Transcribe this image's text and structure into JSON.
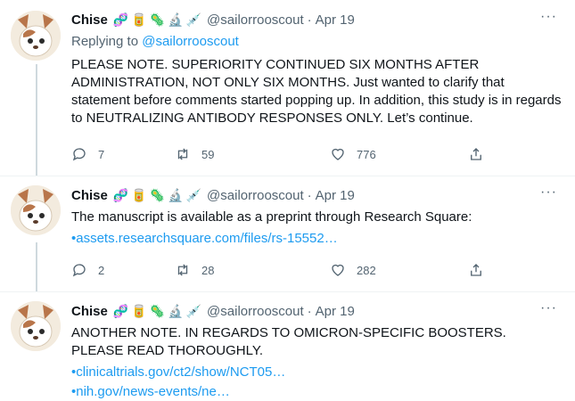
{
  "tweets": [
    {
      "name": "Chise",
      "emoji": [
        "🧬",
        "🥫",
        "🦠",
        "🔬",
        "💉"
      ],
      "handle": "@sailorrooscout",
      "sep": "·",
      "date": "Apr 19",
      "more": "···",
      "replying_prefix": "Replying to",
      "replying_to": "@sailorrooscout",
      "text": "PLEASE NOTE. SUPERIORITY CONTINUED SIX MONTHS AFTER ADMINISTRATION, NOT ONLY SIX MONTHS. Just wanted to clarify that statement before comments started popping up. In addition, this study is in regards to NEUTRALIZING ANTIBODY RESPONSES ONLY. Let’s continue.",
      "replies": "7",
      "retweets": "59",
      "likes": "776"
    },
    {
      "name": "Chise",
      "emoji": [
        "🧬",
        "🥫",
        "🦠",
        "🔬",
        "💉"
      ],
      "handle": "@sailorrooscout",
      "sep": "·",
      "date": "Apr 19",
      "more": "···",
      "text": "The manuscript is available as a preprint through Research Square:",
      "link1": "•assets.researchsquare.com/files/rs-15552…",
      "replies": "2",
      "retweets": "28",
      "likes": "282"
    },
    {
      "name": "Chise",
      "emoji": [
        "🧬",
        "🥫",
        "🦠",
        "🔬",
        "💉"
      ],
      "handle": "@sailorrooscout",
      "sep": "·",
      "date": "Apr 19",
      "more": "···",
      "text": "ANOTHER NOTE. IN REGARDS TO OMICRON-SPECIFIC BOOSTERS. PLEASE READ THOROUGHLY.",
      "link1": "•clinicaltrials.gov/ct2/show/NCT05…",
      "link2": "•nih.gov/news-events/ne…"
    }
  ],
  "icons": {
    "reply": "reply-icon",
    "retweet": "retweet-icon",
    "like": "like-icon",
    "share": "share-icon"
  },
  "colors": {
    "link": "#1d9bf0",
    "secondary": "#536471",
    "thread_line": "#cfd9de"
  }
}
